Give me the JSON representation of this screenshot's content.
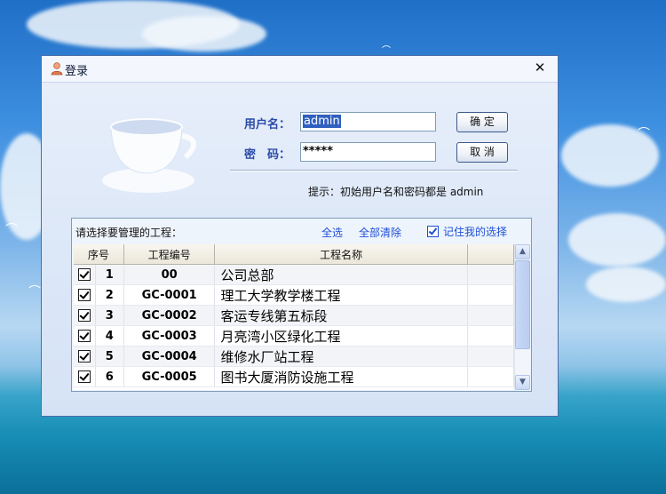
{
  "window": {
    "title": "登录",
    "close_glyph": "✕",
    "icon": "user-icon"
  },
  "login": {
    "username_label": "用户名：",
    "username_value": "admin",
    "password_label": "密　码：",
    "password_value": "*****",
    "ok_button": "确 定",
    "cancel_button": "取 消",
    "hint": "提示：初始用户名和密码都是 admin"
  },
  "projects": {
    "group_title": "请选择要管理的工程：",
    "select_all": "全选",
    "clear_all": "全部清除",
    "remember": "记住我的选择",
    "columns": [
      "序号",
      "工程编号",
      "工程名称"
    ],
    "rows": [
      {
        "num": "1",
        "code": "00",
        "name": "公司总部",
        "checked": true
      },
      {
        "num": "2",
        "code": "GC-0001",
        "name": "理工大学教学楼工程",
        "checked": true
      },
      {
        "num": "3",
        "code": "GC-0002",
        "name": "客运专线第五标段",
        "checked": true
      },
      {
        "num": "4",
        "code": "GC-0003",
        "name": "月亮湾小区绿化工程",
        "checked": true
      },
      {
        "num": "5",
        "code": "GC-0004",
        "name": "维修水厂站工程",
        "checked": true
      },
      {
        "num": "6",
        "code": "GC-0005",
        "name": "图书大厦消防设施工程",
        "checked": true
      }
    ]
  },
  "colors": {
    "label_blue": "#2a4aa8",
    "link_blue": "#1e4fd8",
    "selection": "#2f5fbf"
  }
}
